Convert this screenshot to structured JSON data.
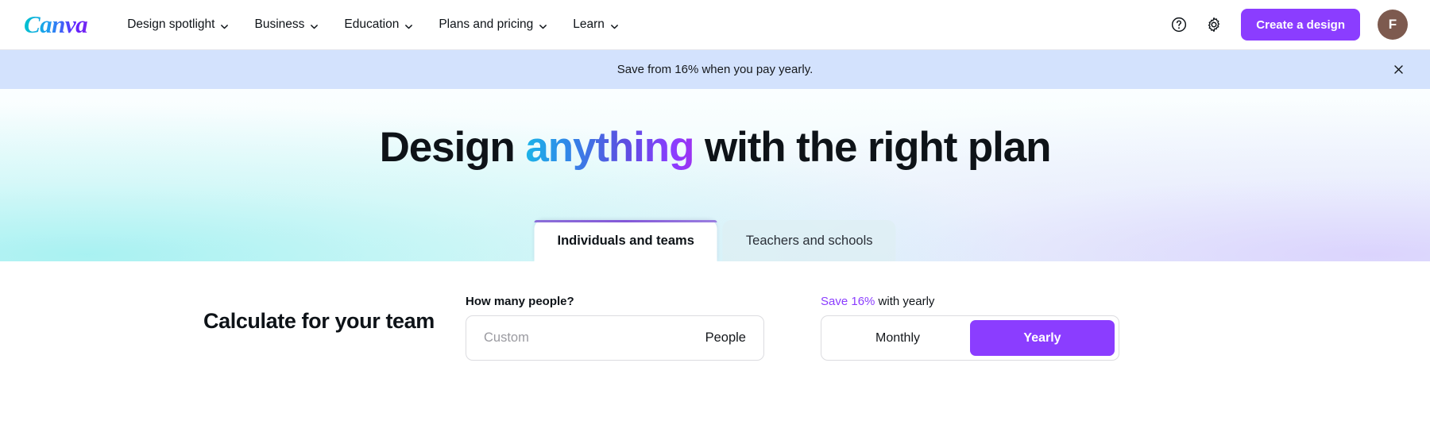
{
  "nav": {
    "logo_text": "Canva",
    "links": [
      {
        "label": "Design spotlight",
        "icon": "chevron-down-icon"
      },
      {
        "label": "Business",
        "icon": "chevron-down-icon"
      },
      {
        "label": "Education",
        "icon": "chevron-down-icon"
      },
      {
        "label": "Plans and pricing",
        "icon": "chevron-down-icon"
      },
      {
        "label": "Learn",
        "icon": "chevron-down-icon"
      }
    ],
    "help_icon": "help-circle-icon",
    "settings_icon": "gear-icon",
    "create_label": "Create a design",
    "avatar_initial": "F",
    "avatar_color": "#7d5a4f",
    "accent_color": "#8b3dff"
  },
  "promo": {
    "text": "Save from 16% when you pay yearly.",
    "close_icon": "close-icon",
    "background_color": "#d3e2fd"
  },
  "hero": {
    "title_part1": "Design ",
    "title_highlight": "anything",
    "title_part2": " with the right plan",
    "tabs": [
      {
        "label": "Individuals and teams",
        "active": true
      },
      {
        "label": "Teachers and schools",
        "active": false
      }
    ]
  },
  "calculator": {
    "title": "Calculate for your team",
    "people": {
      "label": "How many people?",
      "placeholder": "Custom",
      "value": "",
      "unit": "People"
    },
    "billing": {
      "label_accent": "Save 16%",
      "label_rest": " with yearly",
      "options": [
        {
          "label": "Monthly",
          "selected": false
        },
        {
          "label": "Yearly",
          "selected": true
        }
      ]
    }
  }
}
